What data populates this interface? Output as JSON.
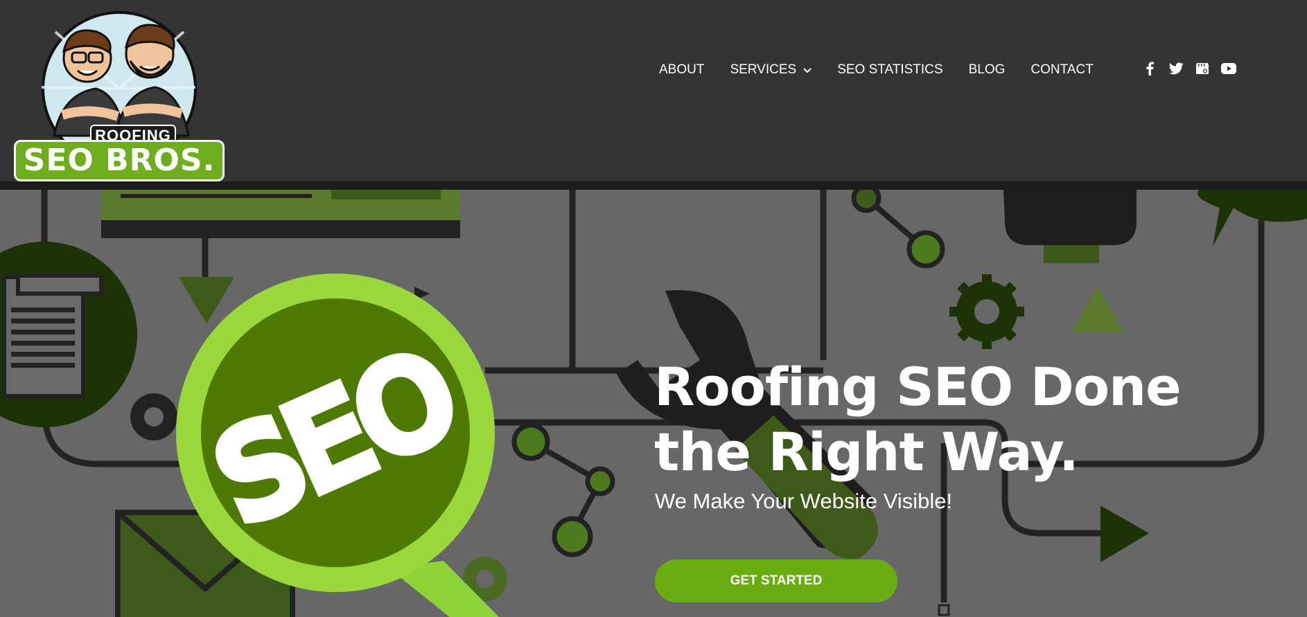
{
  "brand": {
    "logo_top": "ROOFING",
    "logo_main": "SEO BROS.",
    "accent": "#6aad12"
  },
  "nav": {
    "items": [
      {
        "label": "ABOUT"
      },
      {
        "label": "SERVICES",
        "has_dropdown": true
      },
      {
        "label": "SEO STATISTICS"
      },
      {
        "label": "BLOG"
      },
      {
        "label": "CONTACT"
      }
    ]
  },
  "social": [
    "facebook-icon",
    "twitter-icon",
    "google-business-icon",
    "youtube-icon"
  ],
  "hero": {
    "title": "Roofing SEO Done the Right Way.",
    "subtitle": "We Make Your Website Visible!",
    "cta_label": "GET STARTED",
    "illustration_text": "SEO"
  }
}
